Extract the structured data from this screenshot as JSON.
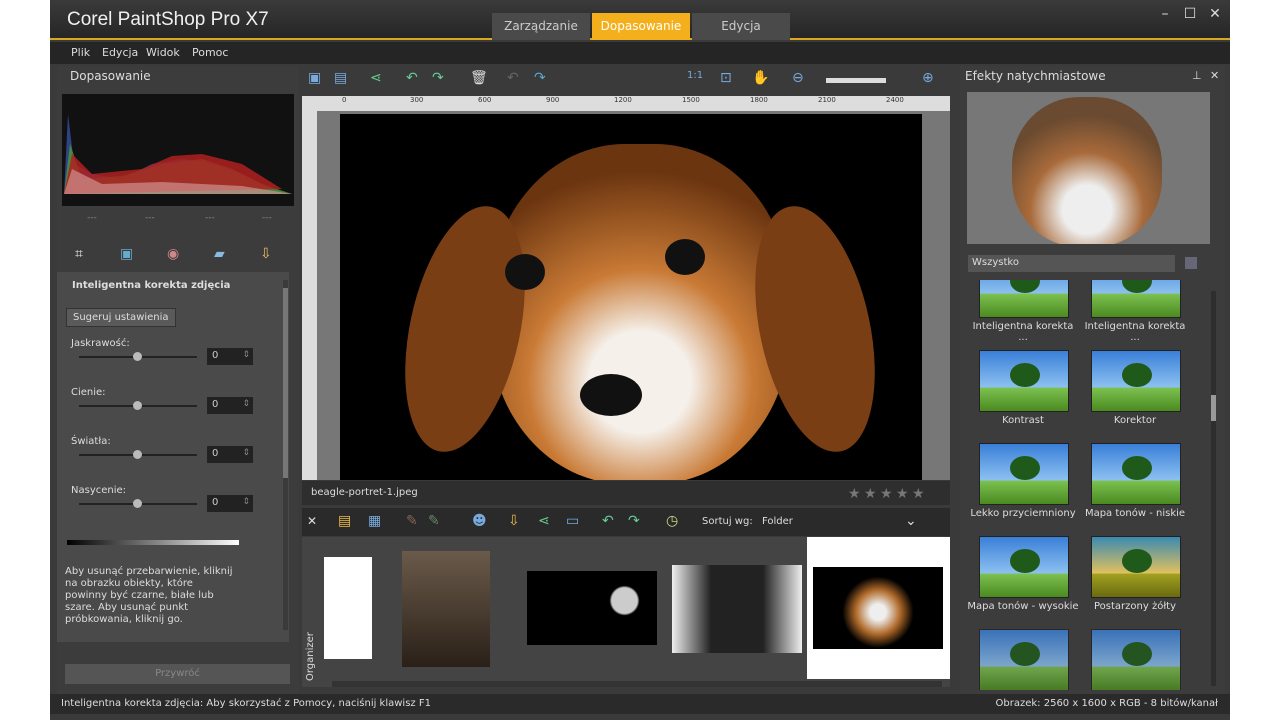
{
  "app": {
    "title": "Corel PaintShop Pro X7"
  },
  "workspace_tabs": [
    {
      "label": "Zarządzanie"
    },
    {
      "label": "Dopasowanie"
    },
    {
      "label": "Edycja"
    }
  ],
  "menu": [
    {
      "label": "Plik"
    },
    {
      "label": "Edycja"
    },
    {
      "label": "Widok"
    },
    {
      "label": "Pomoc"
    }
  ],
  "left_panel": {
    "title": "Dopasowanie",
    "histogram_ticks": [
      "---",
      "---",
      "---",
      "---"
    ],
    "section_title": "Inteligentna korekta zdjęcia",
    "suggest_button": "Sugeruj ustawienia",
    "sliders": [
      {
        "label": "Jaskrawość:",
        "value": "0"
      },
      {
        "label": "Cienie:",
        "value": "0"
      },
      {
        "label": "Światła:",
        "value": "0"
      },
      {
        "label": "Nasycenie:",
        "value": "0"
      }
    ],
    "hint": "Aby usunąć przebarwienie, kliknij na obrazku obiekty, które powinny być czarne, białe lub szare. Aby usunąć punkt próbkowania, kliknij go.",
    "reset_button": "Przywróć"
  },
  "ruler": [
    "0",
    "300",
    "600",
    "900",
    "1200",
    "1500",
    "1800",
    "2100",
    "2400"
  ],
  "image": {
    "filename": "beagle-portret-1.jpeg",
    "rating": 0,
    "max_rating": 5
  },
  "organizer": {
    "sort_label": "Sortuj wg:",
    "sort_value": "Folder",
    "side_label": "Organizer",
    "thumbnail_count": 5,
    "selected_index": 4
  },
  "right_panel": {
    "title": "Efekty natychmiastowe",
    "filter": "Wszystko",
    "effects": [
      {
        "label": "Inteligentna korekta ..."
      },
      {
        "label": "Inteligentna korekta ..."
      },
      {
        "label": "Kontrast"
      },
      {
        "label": "Korektor"
      },
      {
        "label": "Lekko przyciemniony"
      },
      {
        "label": "Mapa tonów - niskie"
      },
      {
        "label": "Mapa tonów - wysokie"
      },
      {
        "label": "Postarzony żółty"
      },
      {
        "label": ""
      },
      {
        "label": ""
      }
    ]
  },
  "status": {
    "left": "Inteligentna korekta zdjęcia: Aby skorzystać z Pomocy, naciśnij klawisz F1",
    "right": "Obrazek:  2560 x 1600 x RGB - 8 bitów/kanał"
  },
  "colors": {
    "accent": "#f4b01c"
  }
}
